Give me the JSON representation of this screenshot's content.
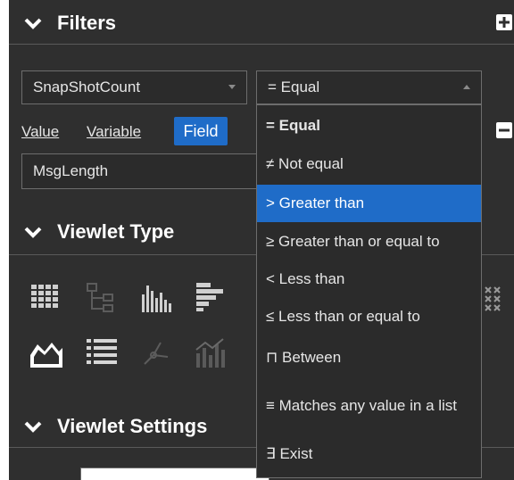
{
  "filters": {
    "title": "Filters",
    "field_select": "SnapShotCount",
    "operator_select": "= Equal",
    "links": {
      "value": "Value",
      "variable": "Variable"
    },
    "field_button": "Field",
    "value_input": "MsgLength"
  },
  "viewlet_type": {
    "title": "Viewlet Type"
  },
  "viewlet_settings": {
    "title": "Viewlet Settings"
  },
  "operator_options": [
    {
      "label": "= Equal",
      "selected": true
    },
    {
      "label": "≠ Not equal"
    },
    {
      "label": "> Greater than",
      "highlighted": true
    },
    {
      "label": "≥ Greater than or equal to"
    },
    {
      "label": "< Less than"
    },
    {
      "label": "≤ Less than or equal to"
    },
    {
      "label": "⊓ Between"
    },
    {
      "label": "≡ Matches any value in a list"
    },
    {
      "label": "∃ Exist"
    }
  ],
  "icons": [
    "chevron-down-icon",
    "plus-icon",
    "minus-icon",
    "grid-table-icon",
    "tree-icon",
    "bar-chart-icon",
    "horizontal-bar-icon",
    "area-chart-icon",
    "list-icon",
    "scatter-icon",
    "combo-chart-icon",
    "matrix-icon"
  ],
  "colors": {
    "panel_bg": "#2f2f2f",
    "accent": "#1f6cc8",
    "text": "#e6e6e6"
  }
}
